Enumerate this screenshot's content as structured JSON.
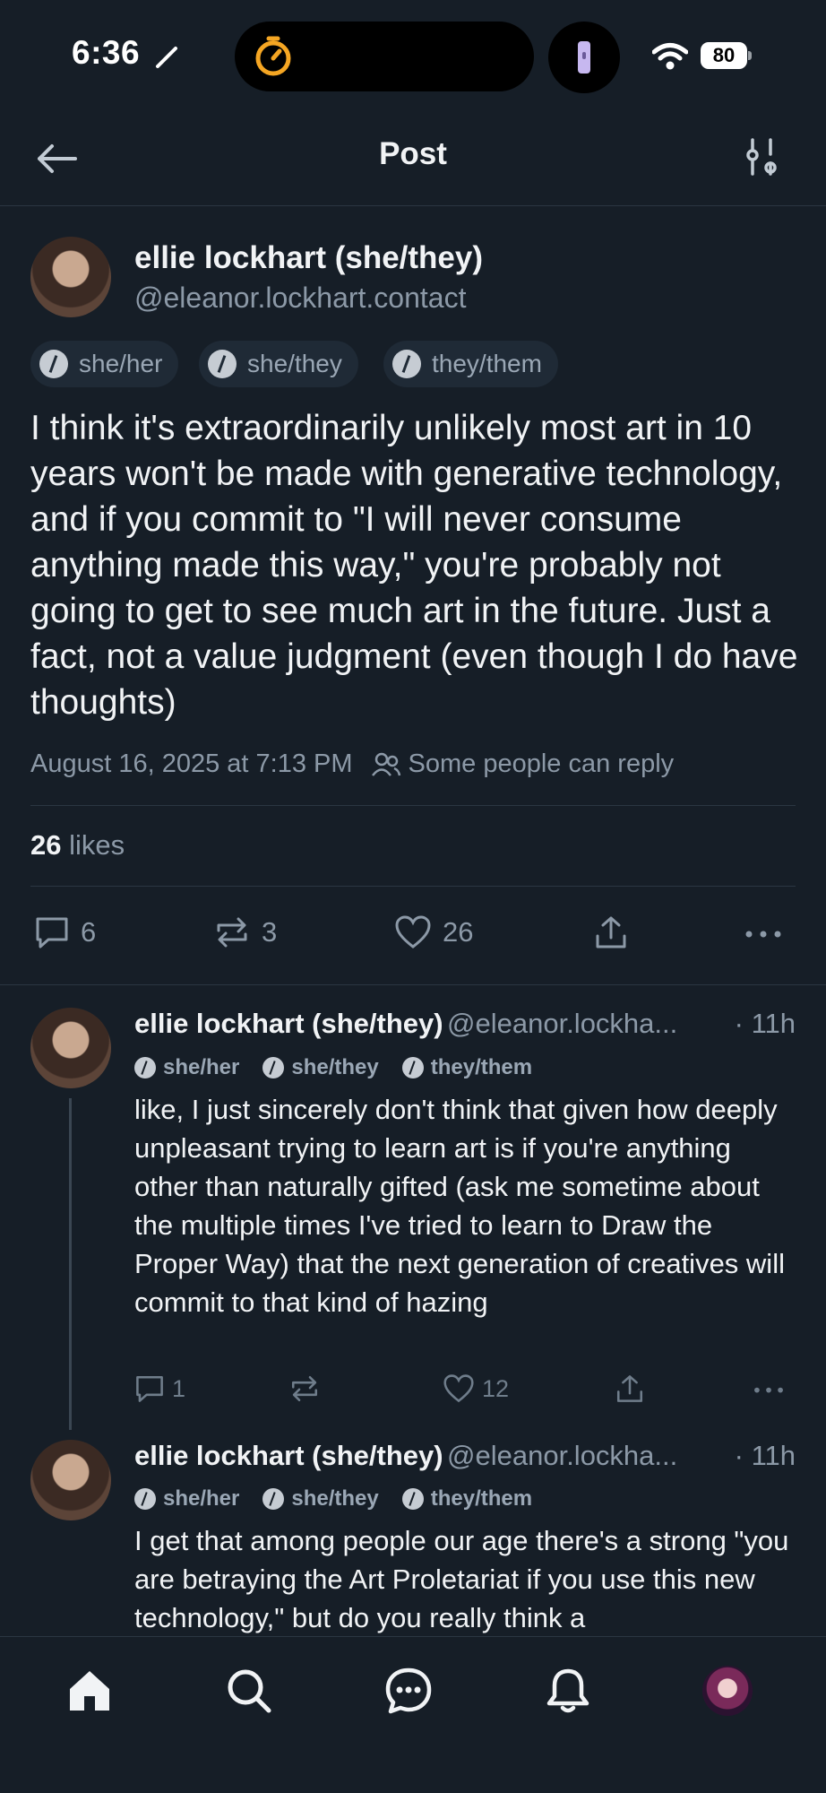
{
  "status_bar": {
    "time": "6:36",
    "battery": "80"
  },
  "header": {
    "title": "Post"
  },
  "post": {
    "author_name": "ellie lockhart (she/they)",
    "author_handle": "@eleanor.lockhart.contact",
    "pronouns": [
      "she/her",
      "she/they",
      "they/them"
    ],
    "text": "I think it's extraordinarily unlikely most art in 10 years won't be made with generative technology, and if you commit to \"I will never consume anything made this way,\" you're probably not going to get to see much art in the future. Just a fact, not a value judgment (even though I do have thoughts)",
    "timestamp": "August 16, 2025 at 7:13 PM",
    "reply_setting": "Some people can reply",
    "likes_count": "26",
    "likes_label": "likes",
    "reply_count": "6",
    "repost_count": "3",
    "like_count": "26"
  },
  "replies": [
    {
      "author_name": "ellie lockhart (she/they)",
      "handle": "@eleanor.lockha...",
      "time": "· 11h",
      "pronouns": [
        "she/her",
        "she/they",
        "they/them"
      ],
      "text": "like, I just sincerely don't think that given how deeply unpleasant trying to learn art is if you're anything other than naturally gifted (ask me sometime about the multiple times I've tried to learn to Draw the Proper Way) that the next generation of creatives will commit to that kind of hazing",
      "reply_count": "1",
      "like_count": "12"
    },
    {
      "author_name": "ellie lockhart (she/they)",
      "handle": "@eleanor.lockha...",
      "time": "· 11h",
      "pronouns": [
        "she/her",
        "she/they",
        "they/them"
      ],
      "text": "I get that among people our age there's a strong \"you are betraying the Art Proletariat if you use this new technology,\" but do you really think a"
    }
  ],
  "colors": {
    "background": "#161e27",
    "accent": "#f5a623",
    "muted": "#8c99a7"
  }
}
